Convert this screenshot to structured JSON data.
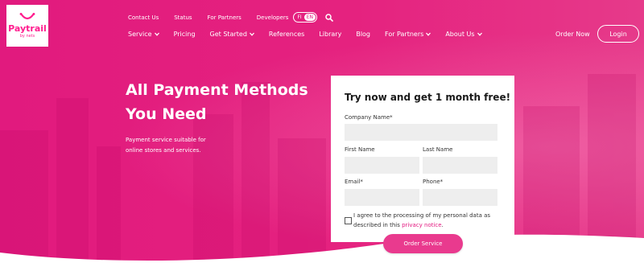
{
  "brand": {
    "name": "Paytrail",
    "sub": "by nets"
  },
  "topnav": {
    "links": [
      "Contact Us",
      "Status",
      "For Partners",
      "Developers"
    ],
    "lang_fi": "FI",
    "lang_en": "EN",
    "search_icon": "search-icon"
  },
  "mainnav": {
    "items": [
      {
        "label": "Service",
        "dropdown": true
      },
      {
        "label": "Pricing",
        "dropdown": false
      },
      {
        "label": "Get Started",
        "dropdown": true
      },
      {
        "label": "References",
        "dropdown": false
      },
      {
        "label": "Library",
        "dropdown": false
      },
      {
        "label": "Blog",
        "dropdown": false
      },
      {
        "label": "For Partners",
        "dropdown": true
      },
      {
        "label": "About Us",
        "dropdown": true
      }
    ],
    "order_now": "Order Now",
    "login": "Login"
  },
  "hero": {
    "title_line1": "All Payment Methods",
    "title_line2": "You Need",
    "subtitle_line1": "Payment service suitable for",
    "subtitle_line2": "online stores and services."
  },
  "form": {
    "heading": "Try now and get 1 month free!",
    "company_label": "Company Name*",
    "first_name_label": "First Name",
    "last_name_label": "Last Name",
    "email_label": "Email*",
    "phone_label": "Phone*",
    "consent_text": "I agree to the processing of my personal data as described in this ",
    "privacy_link": "privacy notice",
    "consent_end": ".",
    "submit": "Order Service"
  },
  "colors": {
    "brand": "#e3177f",
    "button": "#e93a8e",
    "field": "#eeeeee"
  }
}
